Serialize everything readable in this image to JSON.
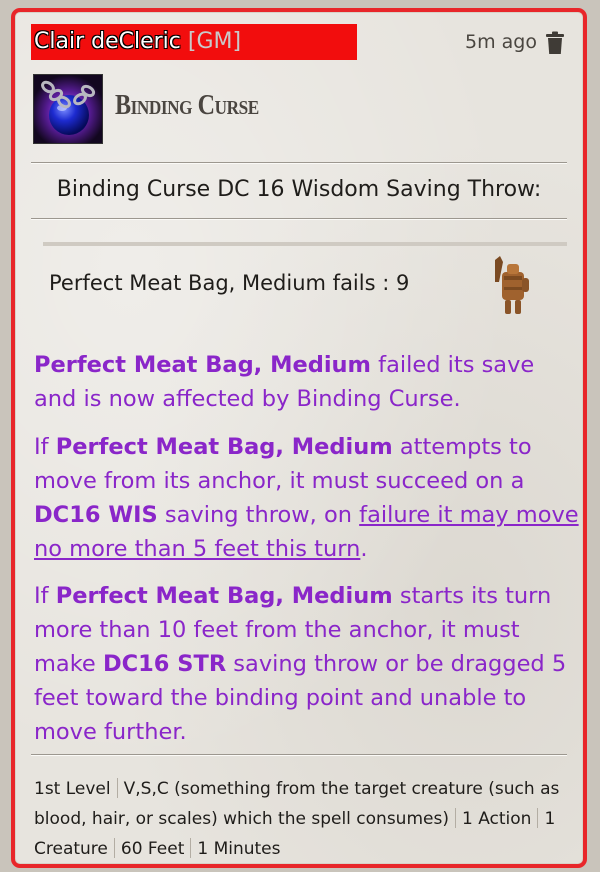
{
  "header": {
    "speaker": "Clair deCleric",
    "role_tag": "[GM]",
    "timestamp": "5m ago",
    "delete_icon": "trash-icon"
  },
  "spell": {
    "name": "Binding Curse",
    "icon": "chained-orb-icon"
  },
  "save": {
    "title": "Binding Curse DC 16 Wisdom Saving Throw:",
    "result_target": "Perfect Meat Bag, Medium",
    "result_outcome": "fails",
    "result_value": "9",
    "token_icon": "wooden-dummy-token-icon"
  },
  "effect": {
    "p1": {
      "target": "Perfect Meat Bag, Medium",
      "text": " failed its save and is now affected by Binding Curse."
    },
    "p2": {
      "lead": "If ",
      "target": "Perfect Meat Bag, Medium",
      "mid1": " attempts to move from its anchor, it must succeed on a ",
      "dc": "DC16 WIS",
      "mid2": " saving throw, on ",
      "underlined": "failure it may move no more than 5 feet this turn",
      "end": "."
    },
    "p3": {
      "lead": "If ",
      "target": "Perfect Meat Bag, Medium",
      "mid1": " starts its turn more than 10 feet from the anchor, it must make ",
      "dc": "DC16 STR",
      "mid2": " saving throw or be dragged 5 feet toward the binding point and unable to move further."
    }
  },
  "footer": {
    "level": "1st Level",
    "components": "V,S,C (something from the target creature (such as blood, hair, or scales) which the spell consumes)",
    "casting_time": "1 Action",
    "targets": "1 Creature",
    "range": "60 Feet",
    "duration": "1 Minutes"
  },
  "colors": {
    "border": "#e8262a",
    "speaker_bg": "#f20d0d",
    "effect_text": "#8a26c9"
  }
}
